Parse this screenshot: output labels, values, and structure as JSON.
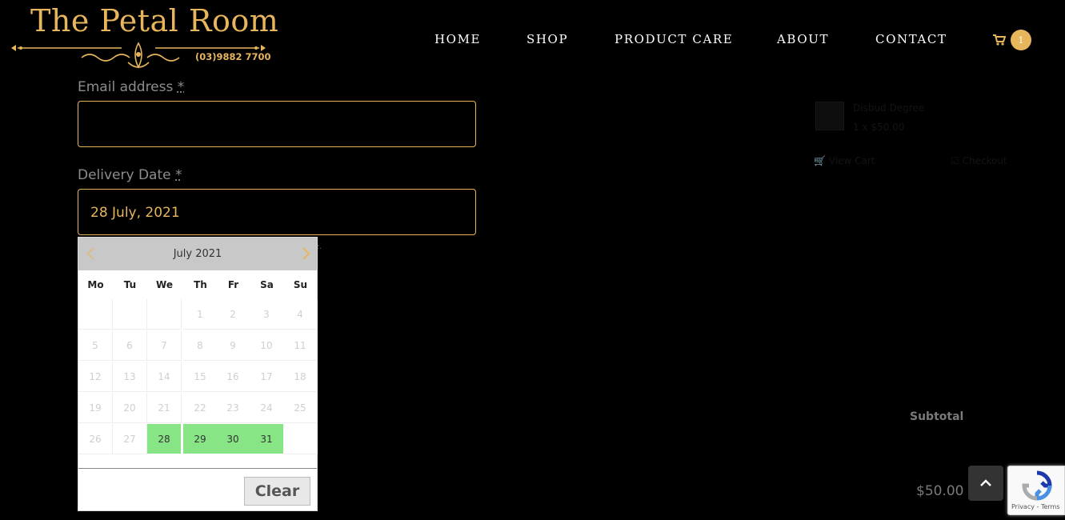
{
  "brand": {
    "name": "The Petal Room",
    "phone": "(03)9882 7700",
    "accent_color": "#e7b55b"
  },
  "nav": {
    "items": [
      {
        "label": "HOME"
      },
      {
        "label": "SHOP"
      },
      {
        "label": "PRODUCT CARE"
      },
      {
        "label": "ABOUT"
      },
      {
        "label": "CONTACT"
      }
    ],
    "cart_icon": "shopping-cart-icon",
    "cart_count": "1"
  },
  "form": {
    "email": {
      "label": "Email address",
      "required_mark": "*",
      "value": ""
    },
    "delivery_date": {
      "label": "Delivery Date",
      "required_mark": "*",
      "value": "28 July, 2021"
    }
  },
  "datepicker": {
    "month_title": "July 2021",
    "prev_icon": "chevron-left-icon",
    "next_icon": "chevron-right-icon",
    "weekdays": [
      "Mo",
      "Tu",
      "We",
      "Th",
      "Fr",
      "Sa",
      "Su"
    ],
    "weeks": [
      [
        "",
        "",
        "",
        "1",
        "2",
        "3",
        "4"
      ],
      [
        "5",
        "6",
        "7",
        "8",
        "9",
        "10",
        "11"
      ],
      [
        "12",
        "13",
        "14",
        "15",
        "16",
        "17",
        "18"
      ],
      [
        "19",
        "20",
        "21",
        "22",
        "23",
        "24",
        "25"
      ],
      [
        "26",
        "27",
        "28",
        "29",
        "30",
        "31",
        ""
      ]
    ],
    "available_days": [
      "28",
      "29",
      "30",
      "31"
    ],
    "available_color": "#87e585",
    "clear_label": "Clear"
  },
  "mini_cart": {
    "product_name": "Disbud Degree",
    "quantity_price": "1 x $50.00",
    "view_cart_label": "View Cart",
    "checkout_label": "Checkout"
  },
  "order_summary": {
    "subtotal_label": "Subtotal",
    "subtotal_value": "$50.00"
  },
  "recaptcha": {
    "terms_text": "Privacy - Terms"
  }
}
